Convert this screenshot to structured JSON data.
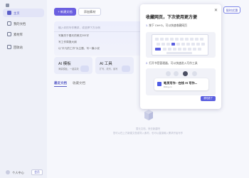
{
  "sidebar": {
    "items": [
      {
        "label": "主页",
        "icon": "home-icon",
        "active": true
      },
      {
        "label": "我的文档",
        "icon": "document-icon",
        "active": false
      },
      {
        "label": "素材库",
        "icon": "library-icon",
        "active": false
      },
      {
        "label": "回收站",
        "icon": "trash-icon",
        "active": false
      }
    ],
    "user": {
      "name": "个人中心",
      "button": "会员"
    }
  },
  "toolbar": {
    "new_doc": "+ 新建文档",
    "add_material": "添加素材",
    "vip": "限时优惠"
  },
  "input": {
    "placeholder": "输入你的写作需求，或选择下方示例",
    "suggestions": [
      "写篇关于春天的美文200字",
      "写工作周报大纲",
      "以\"平凡的工作\"为主题，写一篇小说"
    ]
  },
  "tiles": [
    {
      "title": "AI 模板",
      "sub": "海量模板，一键高效"
    },
    {
      "title": "AI 工具",
      "sub": "扩写、改写、续写"
    }
  ],
  "tabs": [
    {
      "label": "最近文档",
      "active": true
    },
    {
      "label": "收藏文档",
      "active": false
    }
  ],
  "empty": {
    "line1": "暂无文档，快去新建吧",
    "line2": "您可以在上方新建文档或导入素材，也可以直接输入需求开始写作"
  },
  "popup": {
    "title": "收藏网页，下次使用更方便",
    "step1": {
      "num": "1.",
      "text": "按下 Ctrl+D，可以快速收藏网页"
    },
    "step2": {
      "num": "2.",
      "text": "打开书签管理器，可以快速进入写作工具"
    },
    "bookmark_title": "笔灵写作 - 在线 AI 写作...",
    "bookmark_url": "ibiling.cn",
    "button": "我知道了"
  }
}
